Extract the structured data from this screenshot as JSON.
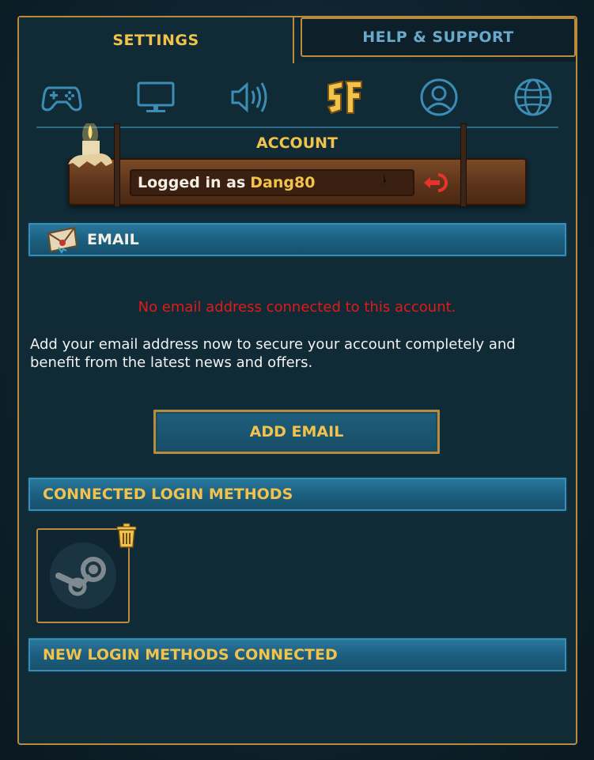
{
  "tabs": {
    "settings": "SETTINGS",
    "help_support": "HELP & SUPPORT"
  },
  "icon_row": [
    {
      "name": "gamepad-icon"
    },
    {
      "name": "monitor-icon"
    },
    {
      "name": "speaker-icon"
    },
    {
      "name": "sf-logo-icon"
    },
    {
      "name": "user-icon"
    },
    {
      "name": "globe-icon"
    }
  ],
  "account": {
    "title": "ACCOUNT",
    "logged_in_prefix": "Logged in as",
    "username": "Dang80"
  },
  "email_section": {
    "title": "EMAIL",
    "warning": "No email address connected to this account.",
    "info": "Add your email address now to secure your account completely and benefit from the latest news and offers.",
    "add_button": "ADD EMAIL"
  },
  "connected_section": {
    "title": "CONNECTED LOGIN METHODS",
    "methods": [
      {
        "icon": "steam-icon"
      }
    ]
  },
  "new_section": {
    "title": "NEW LOGIN METHODS CONNECTED"
  },
  "colors": {
    "accent_gold": "#f2c34c",
    "warning_red": "#e11a1a",
    "bar_blue": "#1c5f80"
  }
}
